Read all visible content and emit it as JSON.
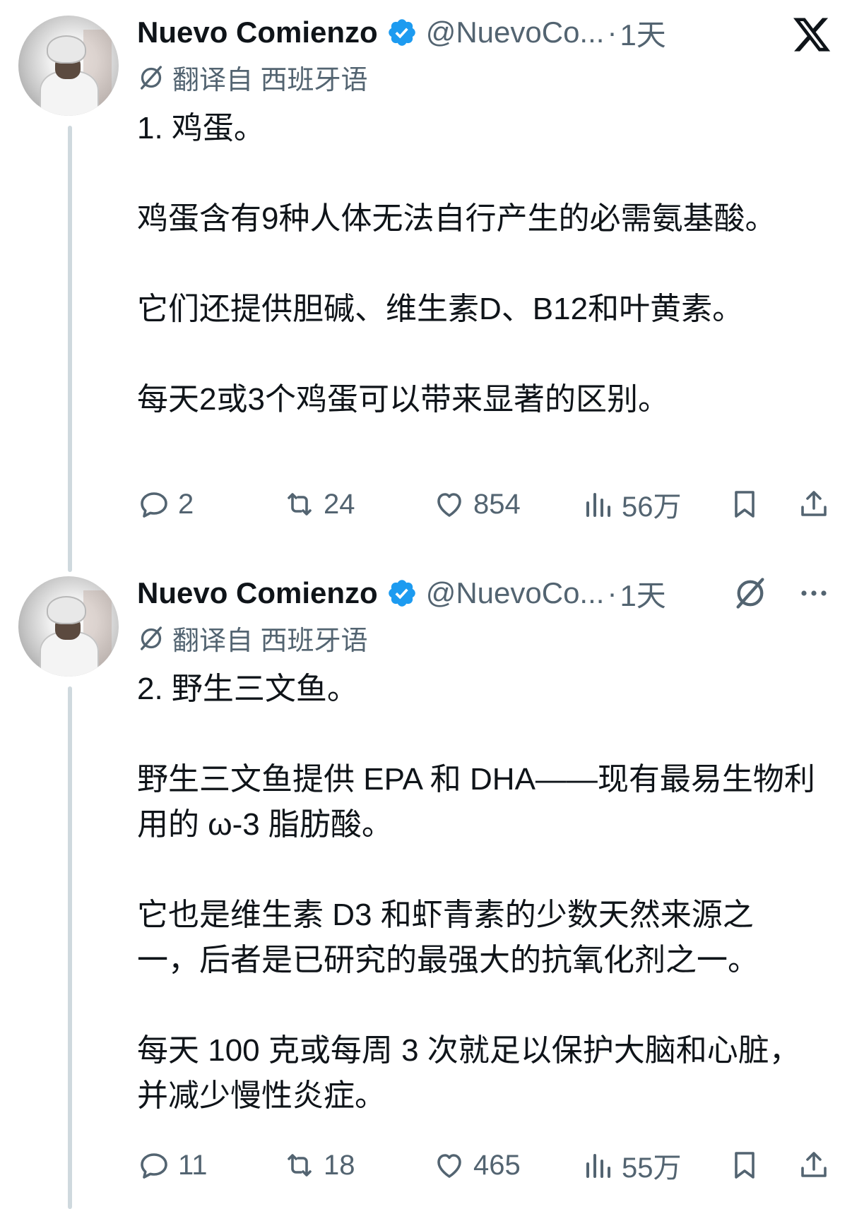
{
  "tweets": [
    {
      "author_name": "Nuevo Comienzo",
      "handle": "@NuevoCo...",
      "dot": "·",
      "time": "1天",
      "translated_label": "翻译自 西班牙语",
      "paragraphs": [
        "1. 鸡蛋。",
        "鸡蛋含有9种人体无法自行产生的必需氨基酸。",
        "它们还提供胆碱、维生素D、B12和叶黄素。",
        "每天2或3个鸡蛋可以带来显著的区别。"
      ],
      "stats": {
        "replies": "2",
        "reposts": "24",
        "likes": "854",
        "views": "56万"
      }
    },
    {
      "author_name": "Nuevo Comienzo",
      "handle": "@NuevoCo...",
      "dot": "·",
      "time": "1天",
      "translated_label": "翻译自 西班牙语",
      "paragraphs": [
        "2. 野生三文鱼。",
        "野生三文鱼提供 EPA 和 DHA——现有最易生物利用的 ω-3 脂肪酸。",
        "它也是维生素 D3 和虾青素的少数天然来源之一，后者是已研究的最强大的抗氧化剂之一。",
        "每天 100 克或每周 3 次就足以保护大脑和心脏，并减少慢性炎症。"
      ],
      "stats": {
        "replies": "11",
        "reposts": "18",
        "likes": "465",
        "views": "55万"
      }
    }
  ],
  "icons": {
    "verified_color": "#1d9bf0",
    "muted_color": "#536471",
    "line_color": "#cfd9de"
  }
}
